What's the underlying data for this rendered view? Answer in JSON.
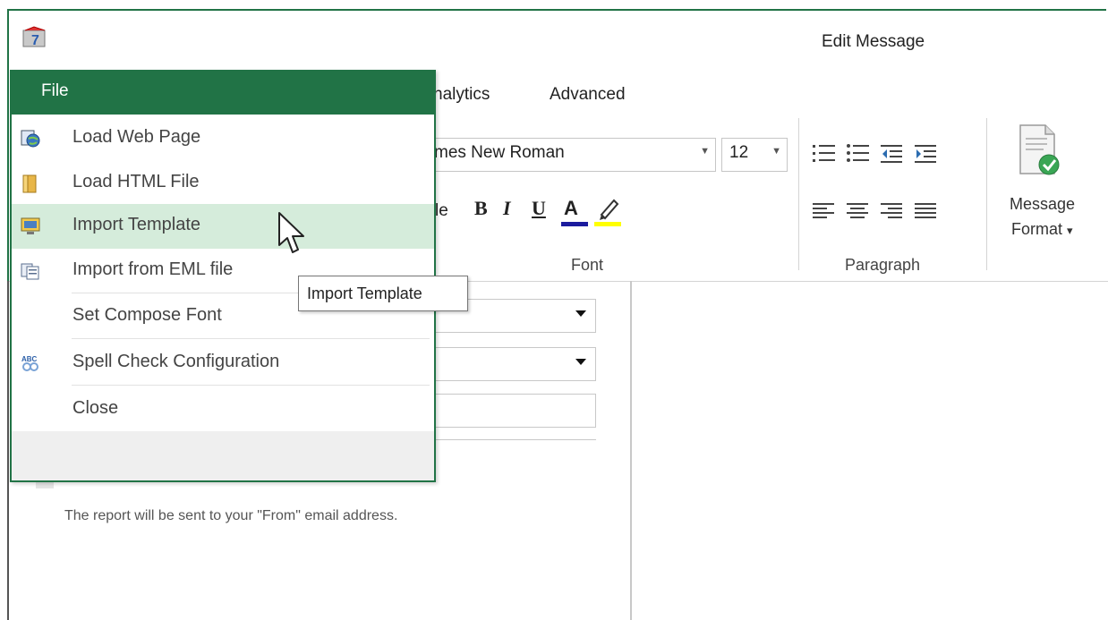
{
  "window": {
    "title": "Edit Message"
  },
  "ribbon": {
    "tabs": [
      {
        "label": "nalytics"
      },
      {
        "label": "Advanced"
      }
    ],
    "font": {
      "name": "mes New Roman",
      "size": "12",
      "style_label": "le",
      "bold": "B",
      "italic": "I",
      "underline": "U",
      "font_color": "A",
      "group_label": "Font"
    },
    "paragraph": {
      "group_label": "Paragraph"
    },
    "message_format": {
      "label_line1": "Message",
      "label_line2": "Format",
      "arrow": "▾"
    }
  },
  "file_menu": {
    "header": "File",
    "items": [
      {
        "label": "Load Web Page",
        "icon": "globe-page-icon"
      },
      {
        "label": "Load HTML File",
        "icon": "folder-icon"
      },
      {
        "label": "Import Template",
        "icon": "template-monitor-icon",
        "highlighted": true
      },
      {
        "label": "Import from EML file",
        "icon": "eml-file-icon"
      },
      {
        "label": "Set Compose Font",
        "icon": ""
      },
      {
        "label": "Spell Check Configuration",
        "icon": "spell-check-icon"
      },
      {
        "label": "Close",
        "icon": ""
      }
    ]
  },
  "tooltip": {
    "text": "Import Template"
  },
  "body": {
    "report_note": "The report will be sent to your \"From\" email address."
  },
  "colors": {
    "accent": "#217346",
    "highlight": "#d5ecdb"
  }
}
